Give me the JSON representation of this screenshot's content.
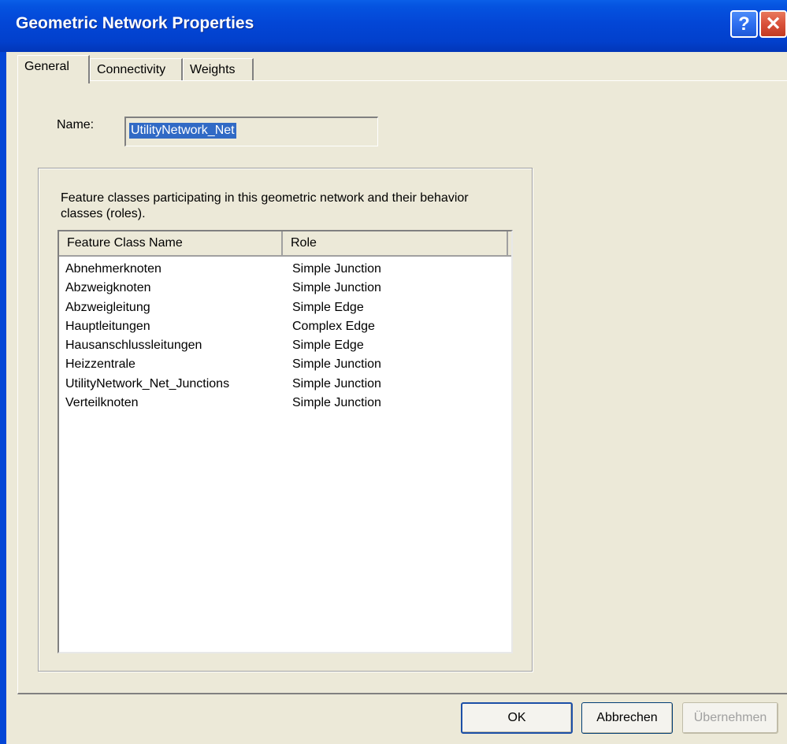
{
  "window": {
    "title": "Geometric Network Properties",
    "help_label": "?",
    "close_label": "✕"
  },
  "tabs": [
    {
      "label": "General",
      "active": true
    },
    {
      "label": "Connectivity",
      "active": false
    },
    {
      "label": "Weights",
      "active": false
    }
  ],
  "general": {
    "name_label": "Name:",
    "name_value": "UtilityNetwork_Net",
    "group_description": "Feature classes participating in this geometric network and their behavior classes (roles).",
    "list": {
      "columns": [
        "Feature Class Name",
        "Role"
      ],
      "rows": [
        [
          "Abnehmerknoten",
          "Simple Junction"
        ],
        [
          "Abzweigknoten",
          "Simple Junction"
        ],
        [
          "Abzweigleitung",
          "Simple Edge"
        ],
        [
          "Hauptleitungen",
          "Complex Edge"
        ],
        [
          "Hausanschlussleitungen",
          "Simple Edge"
        ],
        [
          "Heizzentrale",
          "Simple Junction"
        ],
        [
          "UtilityNetwork_Net_Junctions",
          "Simple Junction"
        ],
        [
          "Verteilknoten",
          "Simple Junction"
        ]
      ]
    }
  },
  "buttons": {
    "ok": "OK",
    "cancel": "Abbrechen",
    "apply": "Übernehmen"
  },
  "colors": {
    "titlebar": "#0346d6",
    "dialog_bg": "#ece9d8",
    "selection": "#316ac5"
  }
}
